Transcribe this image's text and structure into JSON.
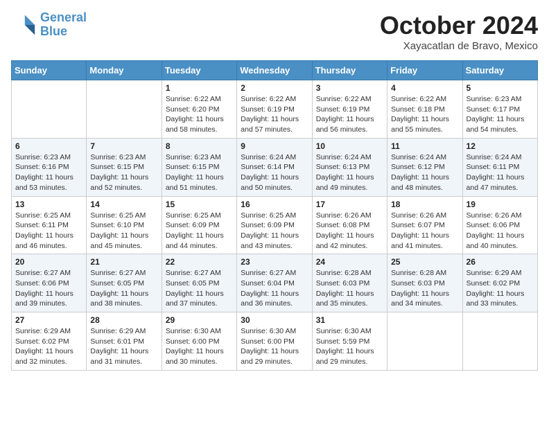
{
  "header": {
    "logo_line1": "General",
    "logo_line2": "Blue",
    "month": "October 2024",
    "location": "Xayacatlan de Bravo, Mexico"
  },
  "weekdays": [
    "Sunday",
    "Monday",
    "Tuesday",
    "Wednesday",
    "Thursday",
    "Friday",
    "Saturday"
  ],
  "weeks": [
    [
      {
        "day": "",
        "info": ""
      },
      {
        "day": "",
        "info": ""
      },
      {
        "day": "1",
        "info": "Sunrise: 6:22 AM\nSunset: 6:20 PM\nDaylight: 11 hours and 58 minutes."
      },
      {
        "day": "2",
        "info": "Sunrise: 6:22 AM\nSunset: 6:19 PM\nDaylight: 11 hours and 57 minutes."
      },
      {
        "day": "3",
        "info": "Sunrise: 6:22 AM\nSunset: 6:19 PM\nDaylight: 11 hours and 56 minutes."
      },
      {
        "day": "4",
        "info": "Sunrise: 6:22 AM\nSunset: 6:18 PM\nDaylight: 11 hours and 55 minutes."
      },
      {
        "day": "5",
        "info": "Sunrise: 6:23 AM\nSunset: 6:17 PM\nDaylight: 11 hours and 54 minutes."
      }
    ],
    [
      {
        "day": "6",
        "info": "Sunrise: 6:23 AM\nSunset: 6:16 PM\nDaylight: 11 hours and 53 minutes."
      },
      {
        "day": "7",
        "info": "Sunrise: 6:23 AM\nSunset: 6:15 PM\nDaylight: 11 hours and 52 minutes."
      },
      {
        "day": "8",
        "info": "Sunrise: 6:23 AM\nSunset: 6:15 PM\nDaylight: 11 hours and 51 minutes."
      },
      {
        "day": "9",
        "info": "Sunrise: 6:24 AM\nSunset: 6:14 PM\nDaylight: 11 hours and 50 minutes."
      },
      {
        "day": "10",
        "info": "Sunrise: 6:24 AM\nSunset: 6:13 PM\nDaylight: 11 hours and 49 minutes."
      },
      {
        "day": "11",
        "info": "Sunrise: 6:24 AM\nSunset: 6:12 PM\nDaylight: 11 hours and 48 minutes."
      },
      {
        "day": "12",
        "info": "Sunrise: 6:24 AM\nSunset: 6:11 PM\nDaylight: 11 hours and 47 minutes."
      }
    ],
    [
      {
        "day": "13",
        "info": "Sunrise: 6:25 AM\nSunset: 6:11 PM\nDaylight: 11 hours and 46 minutes."
      },
      {
        "day": "14",
        "info": "Sunrise: 6:25 AM\nSunset: 6:10 PM\nDaylight: 11 hours and 45 minutes."
      },
      {
        "day": "15",
        "info": "Sunrise: 6:25 AM\nSunset: 6:09 PM\nDaylight: 11 hours and 44 minutes."
      },
      {
        "day": "16",
        "info": "Sunrise: 6:25 AM\nSunset: 6:09 PM\nDaylight: 11 hours and 43 minutes."
      },
      {
        "day": "17",
        "info": "Sunrise: 6:26 AM\nSunset: 6:08 PM\nDaylight: 11 hours and 42 minutes."
      },
      {
        "day": "18",
        "info": "Sunrise: 6:26 AM\nSunset: 6:07 PM\nDaylight: 11 hours and 41 minutes."
      },
      {
        "day": "19",
        "info": "Sunrise: 6:26 AM\nSunset: 6:06 PM\nDaylight: 11 hours and 40 minutes."
      }
    ],
    [
      {
        "day": "20",
        "info": "Sunrise: 6:27 AM\nSunset: 6:06 PM\nDaylight: 11 hours and 39 minutes."
      },
      {
        "day": "21",
        "info": "Sunrise: 6:27 AM\nSunset: 6:05 PM\nDaylight: 11 hours and 38 minutes."
      },
      {
        "day": "22",
        "info": "Sunrise: 6:27 AM\nSunset: 6:05 PM\nDaylight: 11 hours and 37 minutes."
      },
      {
        "day": "23",
        "info": "Sunrise: 6:27 AM\nSunset: 6:04 PM\nDaylight: 11 hours and 36 minutes."
      },
      {
        "day": "24",
        "info": "Sunrise: 6:28 AM\nSunset: 6:03 PM\nDaylight: 11 hours and 35 minutes."
      },
      {
        "day": "25",
        "info": "Sunrise: 6:28 AM\nSunset: 6:03 PM\nDaylight: 11 hours and 34 minutes."
      },
      {
        "day": "26",
        "info": "Sunrise: 6:29 AM\nSunset: 6:02 PM\nDaylight: 11 hours and 33 minutes."
      }
    ],
    [
      {
        "day": "27",
        "info": "Sunrise: 6:29 AM\nSunset: 6:02 PM\nDaylight: 11 hours and 32 minutes."
      },
      {
        "day": "28",
        "info": "Sunrise: 6:29 AM\nSunset: 6:01 PM\nDaylight: 11 hours and 31 minutes."
      },
      {
        "day": "29",
        "info": "Sunrise: 6:30 AM\nSunset: 6:00 PM\nDaylight: 11 hours and 30 minutes."
      },
      {
        "day": "30",
        "info": "Sunrise: 6:30 AM\nSunset: 6:00 PM\nDaylight: 11 hours and 29 minutes."
      },
      {
        "day": "31",
        "info": "Sunrise: 6:30 AM\nSunset: 5:59 PM\nDaylight: 11 hours and 29 minutes."
      },
      {
        "day": "",
        "info": ""
      },
      {
        "day": "",
        "info": ""
      }
    ]
  ]
}
